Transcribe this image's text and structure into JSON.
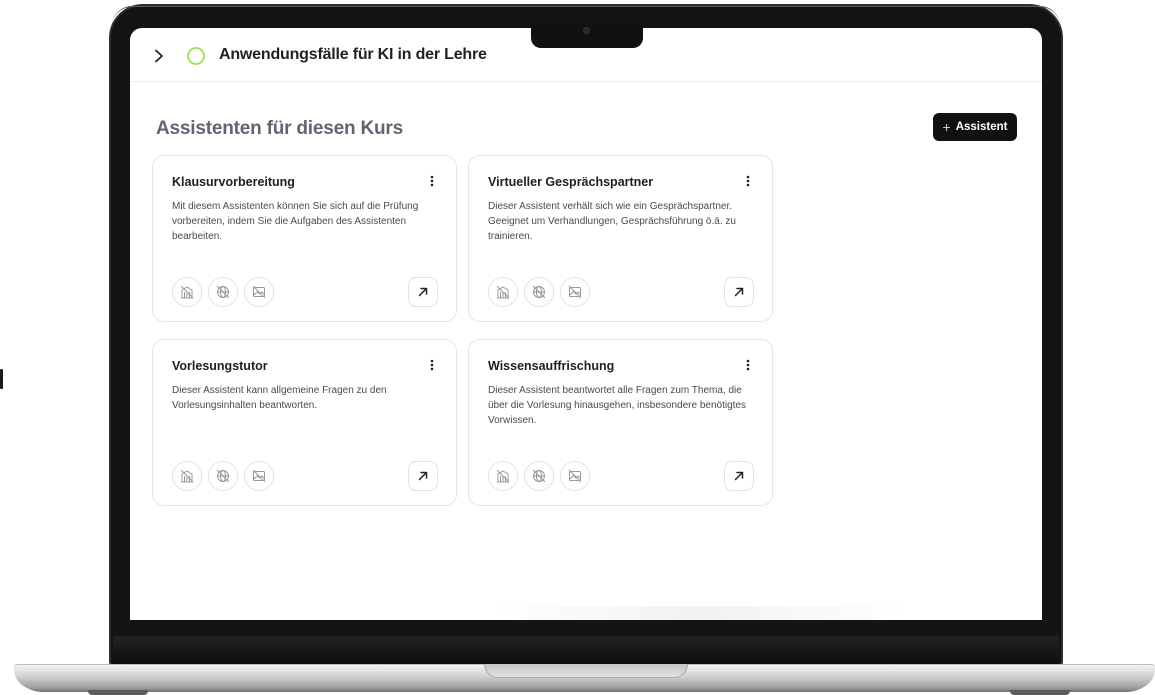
{
  "header": {
    "course_title": "Anwendungsfälle für KI in der Lehre",
    "status_color": "#a7e35a"
  },
  "section": {
    "title": "Assistenten für diesen Kurs",
    "add_button_label": "Assistent"
  },
  "cards": [
    {
      "title": "Klausurvorbereitung",
      "description": "Mit diesem Assistenten können Sie sich auf die Prüfung vorbereiten, indem Sie die Aufgaben des Assistenten bearbeiten."
    },
    {
      "title": "Virtueller Gesprächspartner",
      "description": "Dieser Assistent verhält sich wie ein Gesprächspartner. Geeignet um Verhandlungen, Gesprächsführung ö.ä. zu trainieren."
    },
    {
      "title": "Vorlesungstutor",
      "description": "Dieser Assistent kann allgemeine Fragen zu den Vorlesungsinhalten beantworten."
    },
    {
      "title": "Wissensauffrischung",
      "description": "Dieser Assistent beantwortet alle Fragen zum Thema, die über die Vorlesung hinausgehen, insbesondere benötigtes Vorwissen."
    }
  ],
  "icons": {
    "toggle": "chevron-right-icon",
    "menu": "more-vertical-icon",
    "features": [
      "building-off-icon",
      "globe-off-icon",
      "image-off-icon"
    ],
    "open": "arrow-up-right-icon"
  },
  "colors": {
    "button_bg": "#111111",
    "accent": "#a7e35a"
  }
}
